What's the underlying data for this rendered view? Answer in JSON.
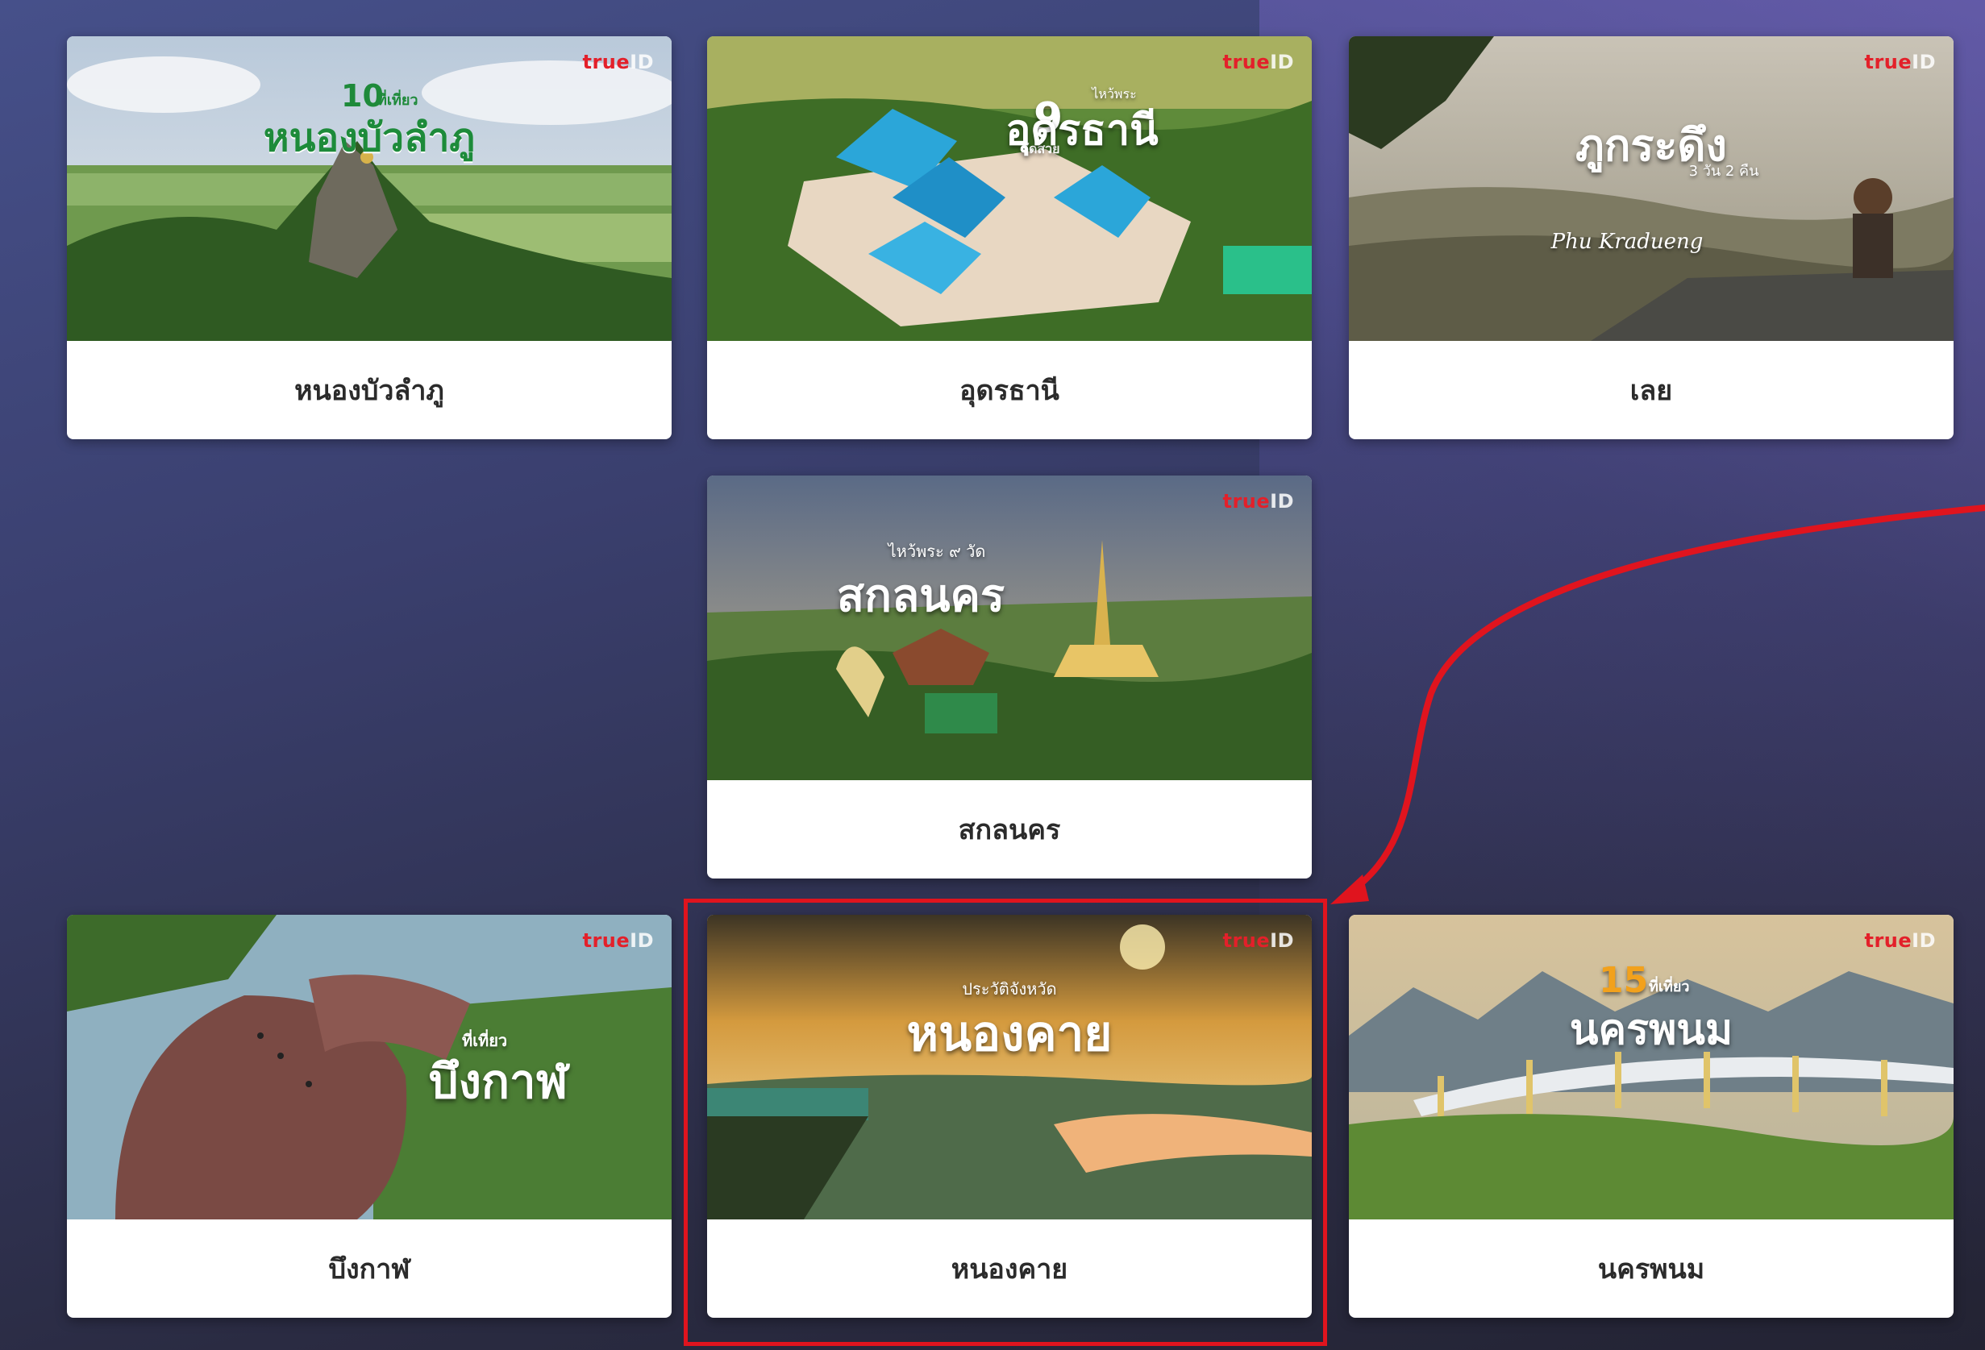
{
  "brand_badge": "true",
  "brand_badge_id": "ID",
  "cards": [
    {
      "label": "หนองบัวลำภู",
      "overlay_number": "10",
      "overlay_unit": "ที่เที่ยว",
      "overlay_title": "หนองบัวลำภู"
    },
    {
      "label": "อุดรธานี",
      "overlay_prefix": "ไหว้พระ",
      "overlay_number": "9",
      "overlay_unit": "วัดสวย",
      "overlay_title": "อุดรธานี"
    },
    {
      "label": "เลย",
      "overlay_title": "ภูกระดึง",
      "overlay_sub": "3 วัน 2 คืน",
      "overlay_script": "Phu Kradueng"
    },
    {
      "label": "สกลนคร",
      "overlay_prefix": "ไหว้พระ ๙ วัด",
      "overlay_title": "สกลนคร"
    },
    {
      "label": "บึงกาฬ",
      "overlay_unit": "ที่เที่ยว",
      "overlay_title": "บึงกาฬ"
    },
    {
      "label": "หนองคาย",
      "overlay_prefix": "ประวัติจังหวัด",
      "overlay_title": "หนองคาย"
    },
    {
      "label": "นครพนม",
      "overlay_number": "15",
      "overlay_unit": "ที่เที่ยว",
      "overlay_title": "นครพนม"
    }
  ],
  "highlight_color": "#e0141e"
}
